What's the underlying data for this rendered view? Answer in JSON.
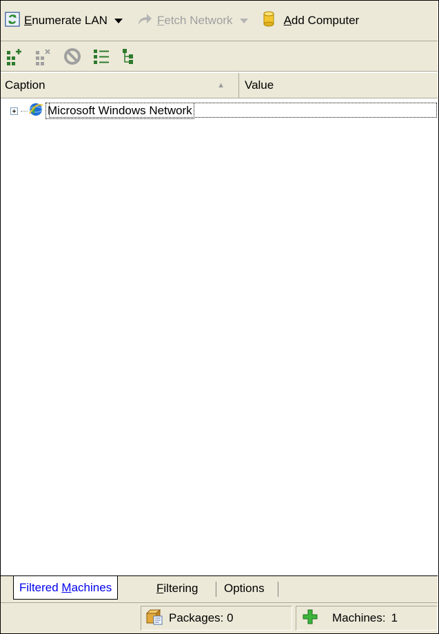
{
  "toolbar": {
    "enumerate_label": "Enumerate LAN",
    "fetch_label": "Fetch Network",
    "add_computer_label": "Add Computer",
    "icons": [
      "add-node-icon",
      "remove-node-icon",
      "cancel-icon",
      "list-view-icon",
      "tree-view-icon"
    ]
  },
  "columns": {
    "caption": "Caption",
    "value": "Value"
  },
  "tree": {
    "items": [
      {
        "label": "Microsoft Windows Network",
        "expanded": false
      }
    ]
  },
  "tabs": [
    {
      "label": "Filtered Machines",
      "active": true
    },
    {
      "label": "Filtering",
      "active": false
    },
    {
      "label": "Options",
      "active": false
    }
  ],
  "status": {
    "packages": "Packages: 0",
    "machines_label": "Machines:",
    "machines_value": "1"
  },
  "colors": {
    "chrome": "#ece9d8",
    "border": "#aca899",
    "active_tab_text": "#0000ee"
  }
}
